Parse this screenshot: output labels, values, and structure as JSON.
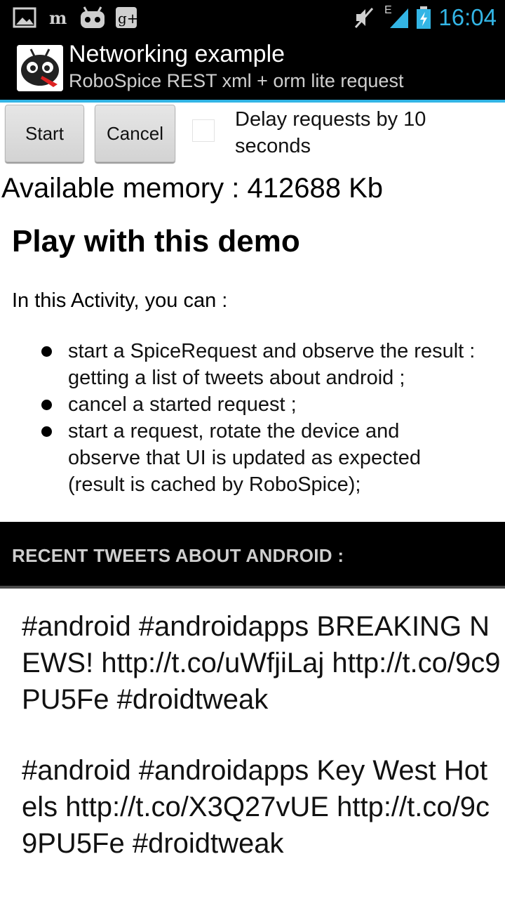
{
  "status_bar": {
    "time": "16:04",
    "network_type": "E",
    "icons": [
      "gallery-icon",
      "newspaper-icon",
      "android-robot-icon",
      "google-plus-icon",
      "mute-icon",
      "signal-icon",
      "battery-charging-icon"
    ]
  },
  "action_bar": {
    "title": "Networking example",
    "subtitle": "RoboSpice REST xml + orm lite request",
    "accent_color": "#33b5e5"
  },
  "controls": {
    "start_label": "Start",
    "cancel_label": "Cancel",
    "delay_label": "Delay requests by 10 seconds",
    "delay_checked": false
  },
  "memory_text": "Available memory : 412688 Kb",
  "demo": {
    "title": "Play with this demo",
    "intro": "In this Activity, you can :",
    "bullets": [
      "start a SpiceRequest and observe the result : getting a list of tweets about android ;",
      "cancel a started request ;",
      "start a request, rotate the device and observe that UI is updated as expected (result is cached by RoboSpice);"
    ]
  },
  "section": {
    "label": "RECENT TWEETS ABOUT ANDROID :"
  },
  "tweets": [
    "#android #androidapps BREAKING NEWS! http://t.co/uWfjiLaj http://t.co/9c9PU5Fe  #droidtweak",
    "#android #androidapps Key West Hotels http://t.co/X3Q27vUE http://t.co/9c9PU5Fe  #droidtweak"
  ]
}
